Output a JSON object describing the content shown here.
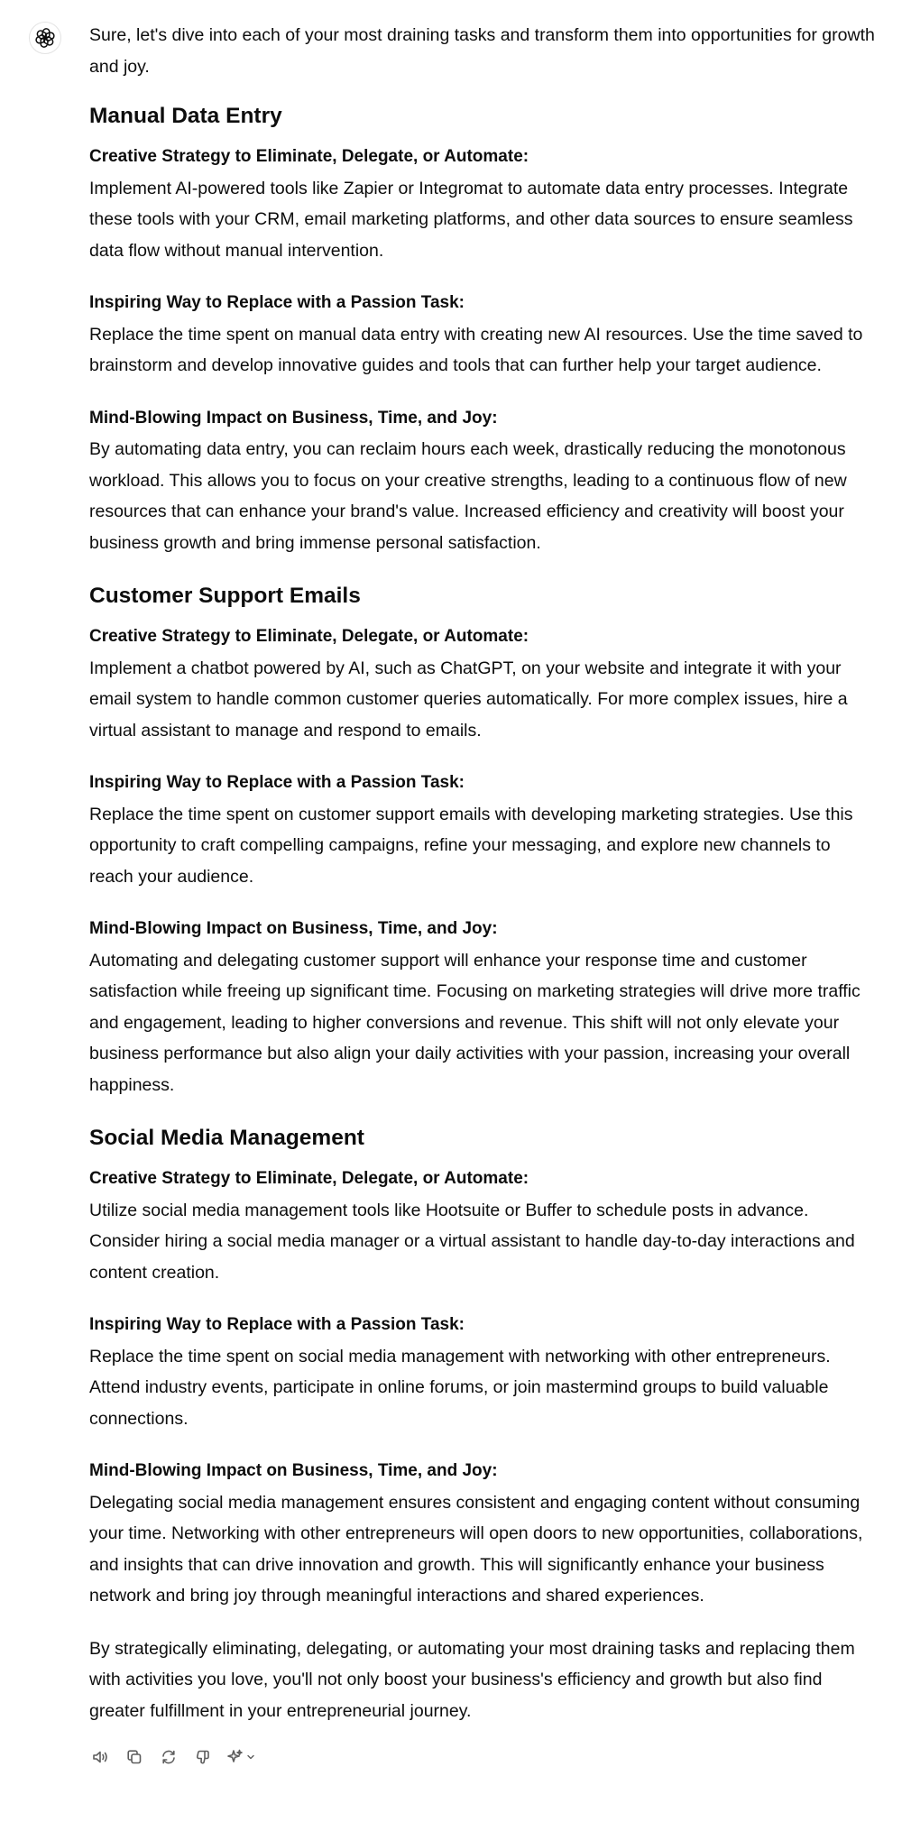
{
  "message": {
    "intro": "Sure, let's dive into each of your most draining tasks and transform them into opportunities for growth and joy.",
    "sections": [
      {
        "title": "Manual Data Entry",
        "items": [
          {
            "heading": "Creative Strategy to Eliminate, Delegate, or Automate:",
            "body": "Implement AI-powered tools like Zapier or Integromat to automate data entry processes. Integrate these tools with your CRM, email marketing platforms, and other data sources to ensure seamless data flow without manual intervention."
          },
          {
            "heading": "Inspiring Way to Replace with a Passion Task:",
            "body": "Replace the time spent on manual data entry with creating new AI resources. Use the time saved to brainstorm and develop innovative guides and tools that can further help your target audience."
          },
          {
            "heading": "Mind-Blowing Impact on Business, Time, and Joy:",
            "body": "By automating data entry, you can reclaim hours each week, drastically reducing the monotonous workload. This allows you to focus on your creative strengths, leading to a continuous flow of new resources that can enhance your brand's value. Increased efficiency and creativity will boost your business growth and bring immense personal satisfaction."
          }
        ]
      },
      {
        "title": "Customer Support Emails",
        "items": [
          {
            "heading": "Creative Strategy to Eliminate, Delegate, or Automate:",
            "body": "Implement a chatbot powered by AI, such as ChatGPT, on your website and integrate it with your email system to handle common customer queries automatically. For more complex issues, hire a virtual assistant to manage and respond to emails."
          },
          {
            "heading": "Inspiring Way to Replace with a Passion Task:",
            "body": "Replace the time spent on customer support emails with developing marketing strategies. Use this opportunity to craft compelling campaigns, refine your messaging, and explore new channels to reach your audience."
          },
          {
            "heading": "Mind-Blowing Impact on Business, Time, and Joy:",
            "body": "Automating and delegating customer support will enhance your response time and customer satisfaction while freeing up significant time. Focusing on marketing strategies will drive more traffic and engagement, leading to higher conversions and revenue. This shift will not only elevate your business performance but also align your daily activities with your passion, increasing your overall happiness."
          }
        ]
      },
      {
        "title": "Social Media Management",
        "items": [
          {
            "heading": "Creative Strategy to Eliminate, Delegate, or Automate:",
            "body": "Utilize social media management tools like Hootsuite or Buffer to schedule posts in advance. Consider hiring a social media manager or a virtual assistant to handle day-to-day interactions and content creation."
          },
          {
            "heading": "Inspiring Way to Replace with a Passion Task:",
            "body": "Replace the time spent on social media management with networking with other entrepreneurs. Attend industry events, participate in online forums, or join mastermind groups to build valuable connections."
          },
          {
            "heading": "Mind-Blowing Impact on Business, Time, and Joy:",
            "body": "Delegating social media management ensures consistent and engaging content without consuming your time. Networking with other entrepreneurs will open doors to new opportunities, collaborations, and insights that can drive innovation and growth. This will significantly enhance your business network and bring joy through meaningful interactions and shared experiences."
          }
        ]
      }
    ],
    "outro": "By strategically eliminating, delegating, or automating your most draining tasks and replacing them with activities you love, you'll not only boost your business's efficiency and growth but also find greater fulfillment in your entrepreneurial journey."
  },
  "icons": {
    "avatar": "openai-logo-icon",
    "actions": [
      "read-aloud-icon",
      "copy-icon",
      "regenerate-icon",
      "thumbs-down-icon",
      "sparkle-icon",
      "chevron-down-icon"
    ]
  },
  "colors": {
    "text": "#0d0d0d",
    "icon": "#5d5d5d"
  }
}
